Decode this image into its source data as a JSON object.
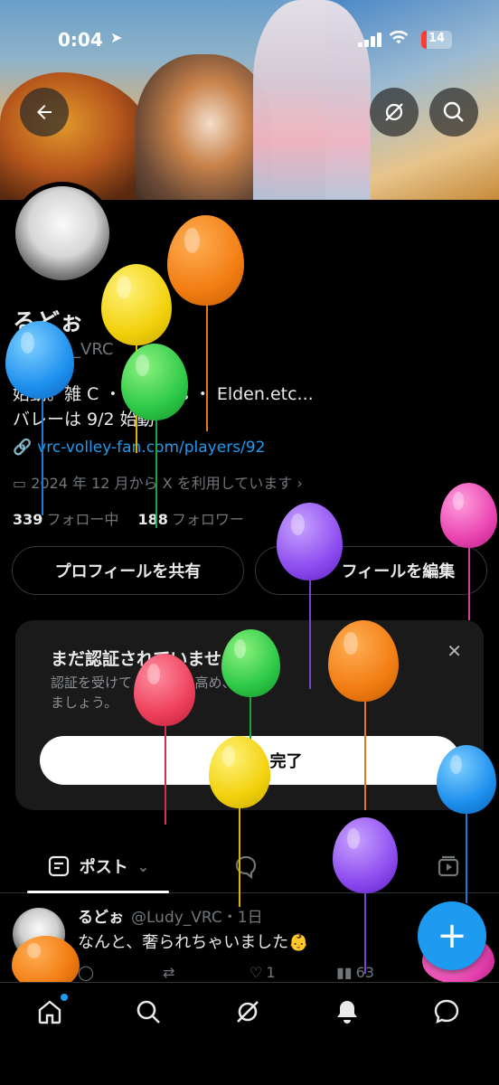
{
  "status_bar": {
    "time": "0:04",
    "battery": "14"
  },
  "profile": {
    "name": "るどぉ",
    "handle": "_VRC",
    "bio_line1": "始動。雑       C ・ Limbus ・ Elden.etc...",
    "bio_line2": "バレーは 9/2 始動",
    "link": "vrc-volley-fan.com/players/92",
    "joined": "2024 年 12 月から X を利用しています",
    "following_count": "339",
    "following_label": "フォロー中",
    "followers_count": "188",
    "followers_label": "フォロワー"
  },
  "buttons": {
    "share": "プロフィールを共有",
    "edit": "フィールを編集"
  },
  "verify_card": {
    "title": "まだ認証されていませ",
    "desc_line1": "認証を受けて          ントの          を高め、          なげ",
    "desc_line2": "ましょう。",
    "cta": "完了"
  },
  "tabs": {
    "post_label": "ポスト"
  },
  "post": {
    "author": "るどぉ",
    "meta": "@Ludy_VRC・1日",
    "text": "なんと、奢られちゃいました👶",
    "likes": "1",
    "views": "63"
  },
  "colors": {
    "accent": "#1d9bf0",
    "background": "#000000",
    "card": "#1a1a1a",
    "muted": "#71767b"
  },
  "icons": {
    "back": "arrow-left-icon",
    "grok": "grok-icon",
    "search": "search-icon",
    "link": "link-icon",
    "calendar": "calendar-icon",
    "close": "close-icon",
    "post": "post-icon",
    "chevron": "chevron-down-icon",
    "replies": "reply-icon",
    "media": "media-icon",
    "compose": "plus-icon",
    "home": "home-icon",
    "explore": "search-icon",
    "notifications": "bell-icon",
    "messages": "message-icon"
  }
}
